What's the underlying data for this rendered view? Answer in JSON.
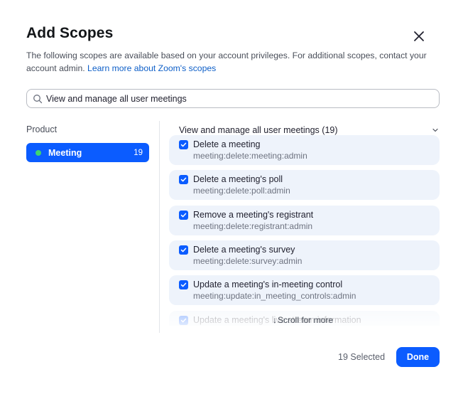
{
  "dialog": {
    "title": "Add Scopes",
    "description": "The following scopes are available based on your account privileges. For additional scopes, contact your account admin.",
    "learn_more_link": "Learn more about Zoom's scopes",
    "close_icon": "close-icon"
  },
  "search": {
    "icon": "search-icon",
    "value": "View and manage all user meetings"
  },
  "sidebar": {
    "label": "Product",
    "items": [
      {
        "name": "Meeting",
        "count": "19",
        "status_color": "#3fd46f",
        "selected": true
      }
    ]
  },
  "group": {
    "title": "View and manage all user meetings (19)",
    "icon": "chevron-down-icon"
  },
  "scopes": [
    {
      "name": "Delete a meeting",
      "id": "meeting:delete:meeting:admin",
      "checked": true
    },
    {
      "name": "Delete a meeting's poll",
      "id": "meeting:delete:poll:admin",
      "checked": true
    },
    {
      "name": "Remove a meeting's registrant",
      "id": "meeting:delete:registrant:admin",
      "checked": true
    },
    {
      "name": "Delete a meeting's survey",
      "id": "meeting:delete:survey:admin",
      "checked": true
    },
    {
      "name": "Update a meeting's in-meeting control",
      "id": "meeting:update:in_meeting_controls:admin",
      "checked": true
    },
    {
      "name": "Update a meeting's live stream information",
      "id": "",
      "checked": true
    }
  ],
  "scroll_hint": {
    "text": "Scroll for more",
    "icon": "arrow-down-icon"
  },
  "footer": {
    "selected_text": "19 Selected",
    "done_label": "Done"
  },
  "colors": {
    "accent": "#0b5cff",
    "row_background": "#eef3fb",
    "link": "#0e5fc8"
  }
}
